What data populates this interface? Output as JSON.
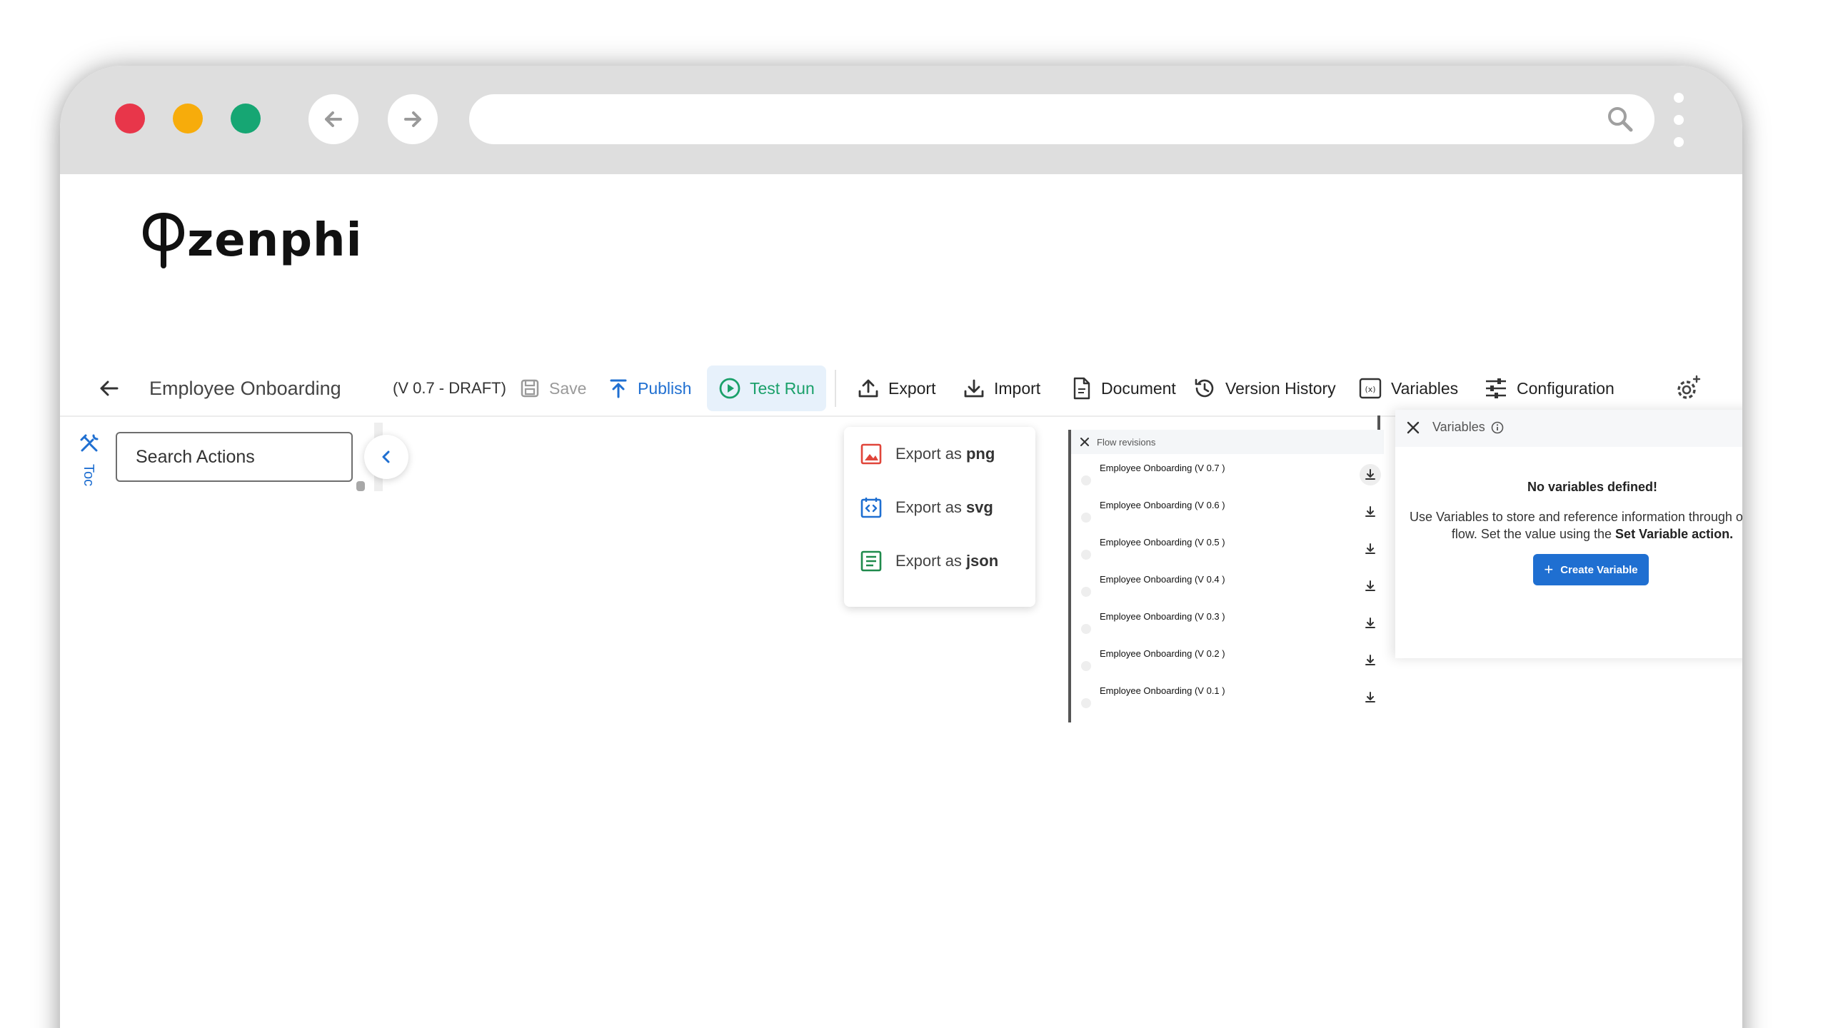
{
  "brand": {
    "name": "zenphi"
  },
  "toolbar": {
    "flow_title": "Employee Onboarding",
    "version": "(V 0.7 - DRAFT)",
    "save_label": "Save",
    "publish_label": "Publish",
    "test_run_label": "Test Run",
    "export_label": "Export",
    "import_label": "Import",
    "document_label": "Document",
    "version_history_label": "Version History",
    "variables_label": "Variables",
    "configuration_label": "Configuration"
  },
  "sidebar": {
    "rail_label": "Toc",
    "search_placeholder": "Search Actions"
  },
  "export_menu": {
    "prefix": "Export as",
    "items": [
      {
        "format": "png",
        "icon": "image-icon",
        "color": "#e0453a"
      },
      {
        "format": "svg",
        "icon": "code-icon",
        "color": "#1f6fd1"
      },
      {
        "format": "json",
        "icon": "list-icon",
        "color": "#1f8a4c"
      }
    ]
  },
  "revisions": {
    "title": "Flow revisions",
    "items": [
      "Employee Onboarding (V 0.7 )",
      "Employee Onboarding (V 0.6 )",
      "Employee Onboarding (V 0.5 )",
      "Employee Onboarding (V 0.4 )",
      "Employee Onboarding (V 0.3 )",
      "Employee Onboarding (V 0.2 )",
      "Employee Onboarding (V 0.1 )"
    ]
  },
  "variables_panel": {
    "title": "Variables",
    "empty_title": "No variables defined!",
    "description": "Use Variables to store and reference information through out the flow. Set the value using the",
    "description_bold": "Set Variable action.",
    "create_label": "Create Variable"
  },
  "colors": {
    "accent": "#1f6fd1",
    "test_run": "#1aa06a",
    "test_run_bg": "#e7f1fb"
  }
}
